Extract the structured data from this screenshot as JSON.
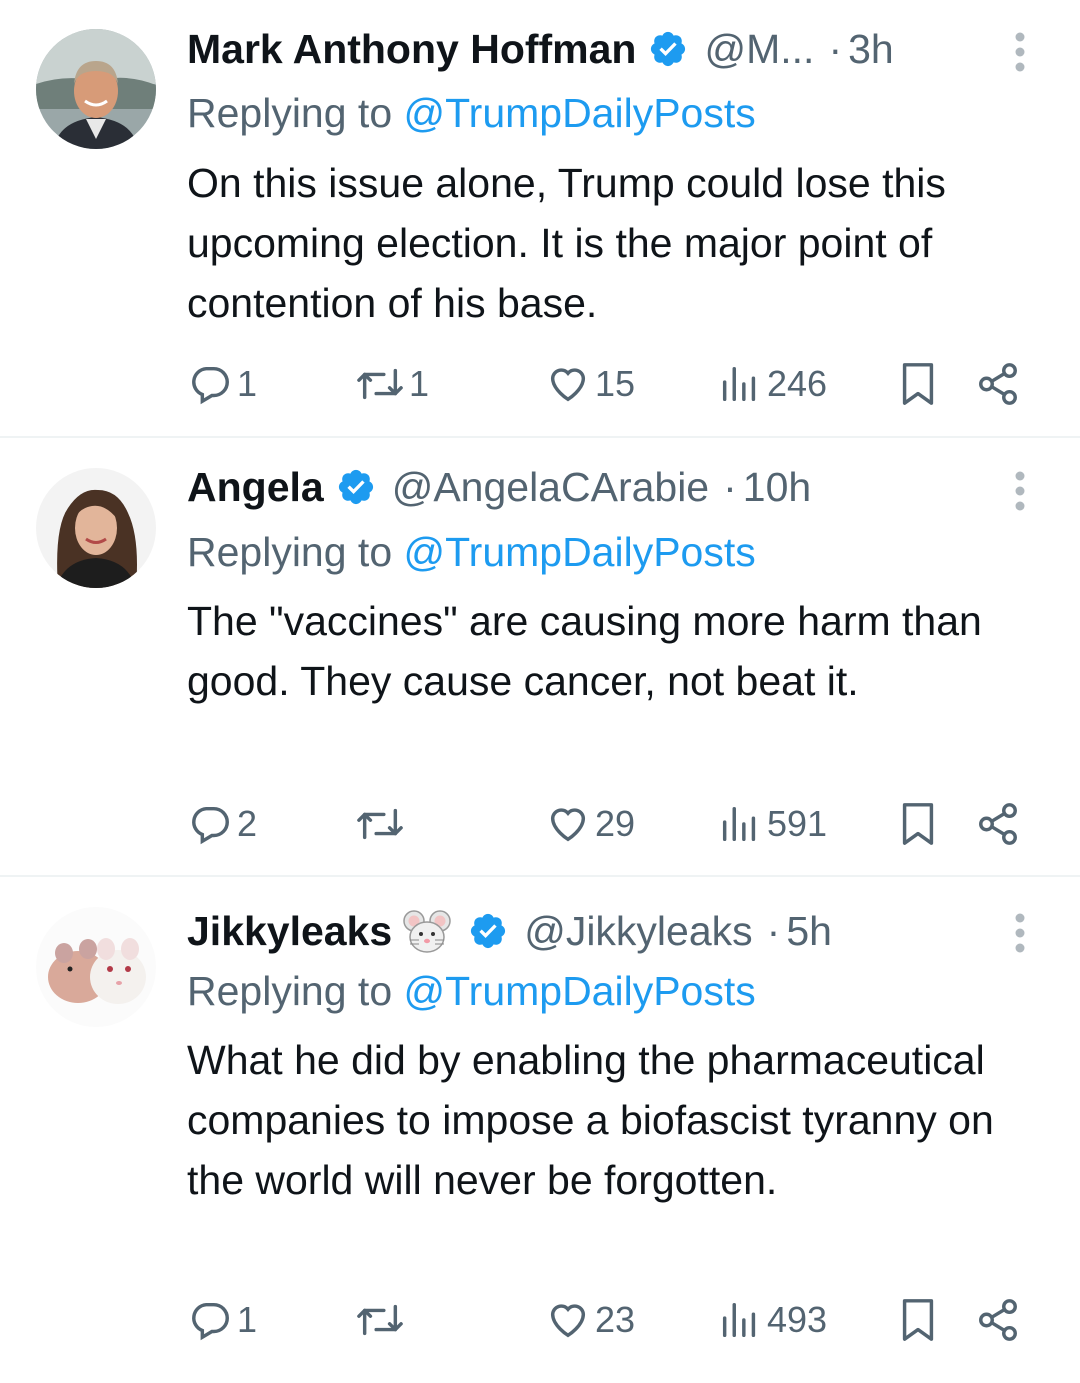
{
  "tweets": [
    {
      "name": "Mark Anthony Hoffman",
      "handle": "@M...",
      "time": "3h",
      "replying_prefix": "Replying to ",
      "replying_to": "@TrumpDailyPosts",
      "text": "On this issue alone, Trump could lose this upcoming election. It is the major point of contention of his base.",
      "replies": "1",
      "retweets": "1",
      "likes": "15",
      "views": "246"
    },
    {
      "name": "Angela",
      "handle": "@AngelaCArabie",
      "time": "10h",
      "replying_prefix": "Replying to ",
      "replying_to": "@TrumpDailyPosts",
      "text": "The \"vaccines\" are causing more harm than good. They cause cancer, not beat it.",
      "replies": "2",
      "retweets": "",
      "likes": "29",
      "views": "591"
    },
    {
      "name": "Jikkyleaks",
      "handle": "@Jikkyleaks",
      "time": "5h",
      "replying_prefix": "Replying to ",
      "replying_to": "@TrumpDailyPosts",
      "text": "What he did by enabling the pharmaceutical companies to impose a biofascist tyranny on the world will never be forgotten.",
      "replies": "1",
      "retweets": "",
      "likes": "23",
      "views": "493"
    }
  ],
  "separator": "·",
  "colors": {
    "accent": "#1d9bf0",
    "secondary": "#536471",
    "text": "#0f1419",
    "divider": "#eff3f4"
  },
  "icons": [
    "verified-badge-icon",
    "more-icon",
    "reply-icon",
    "retweet-icon",
    "like-icon",
    "views-icon",
    "bookmark-icon",
    "share-icon",
    "mouse-emoji-icon"
  ]
}
